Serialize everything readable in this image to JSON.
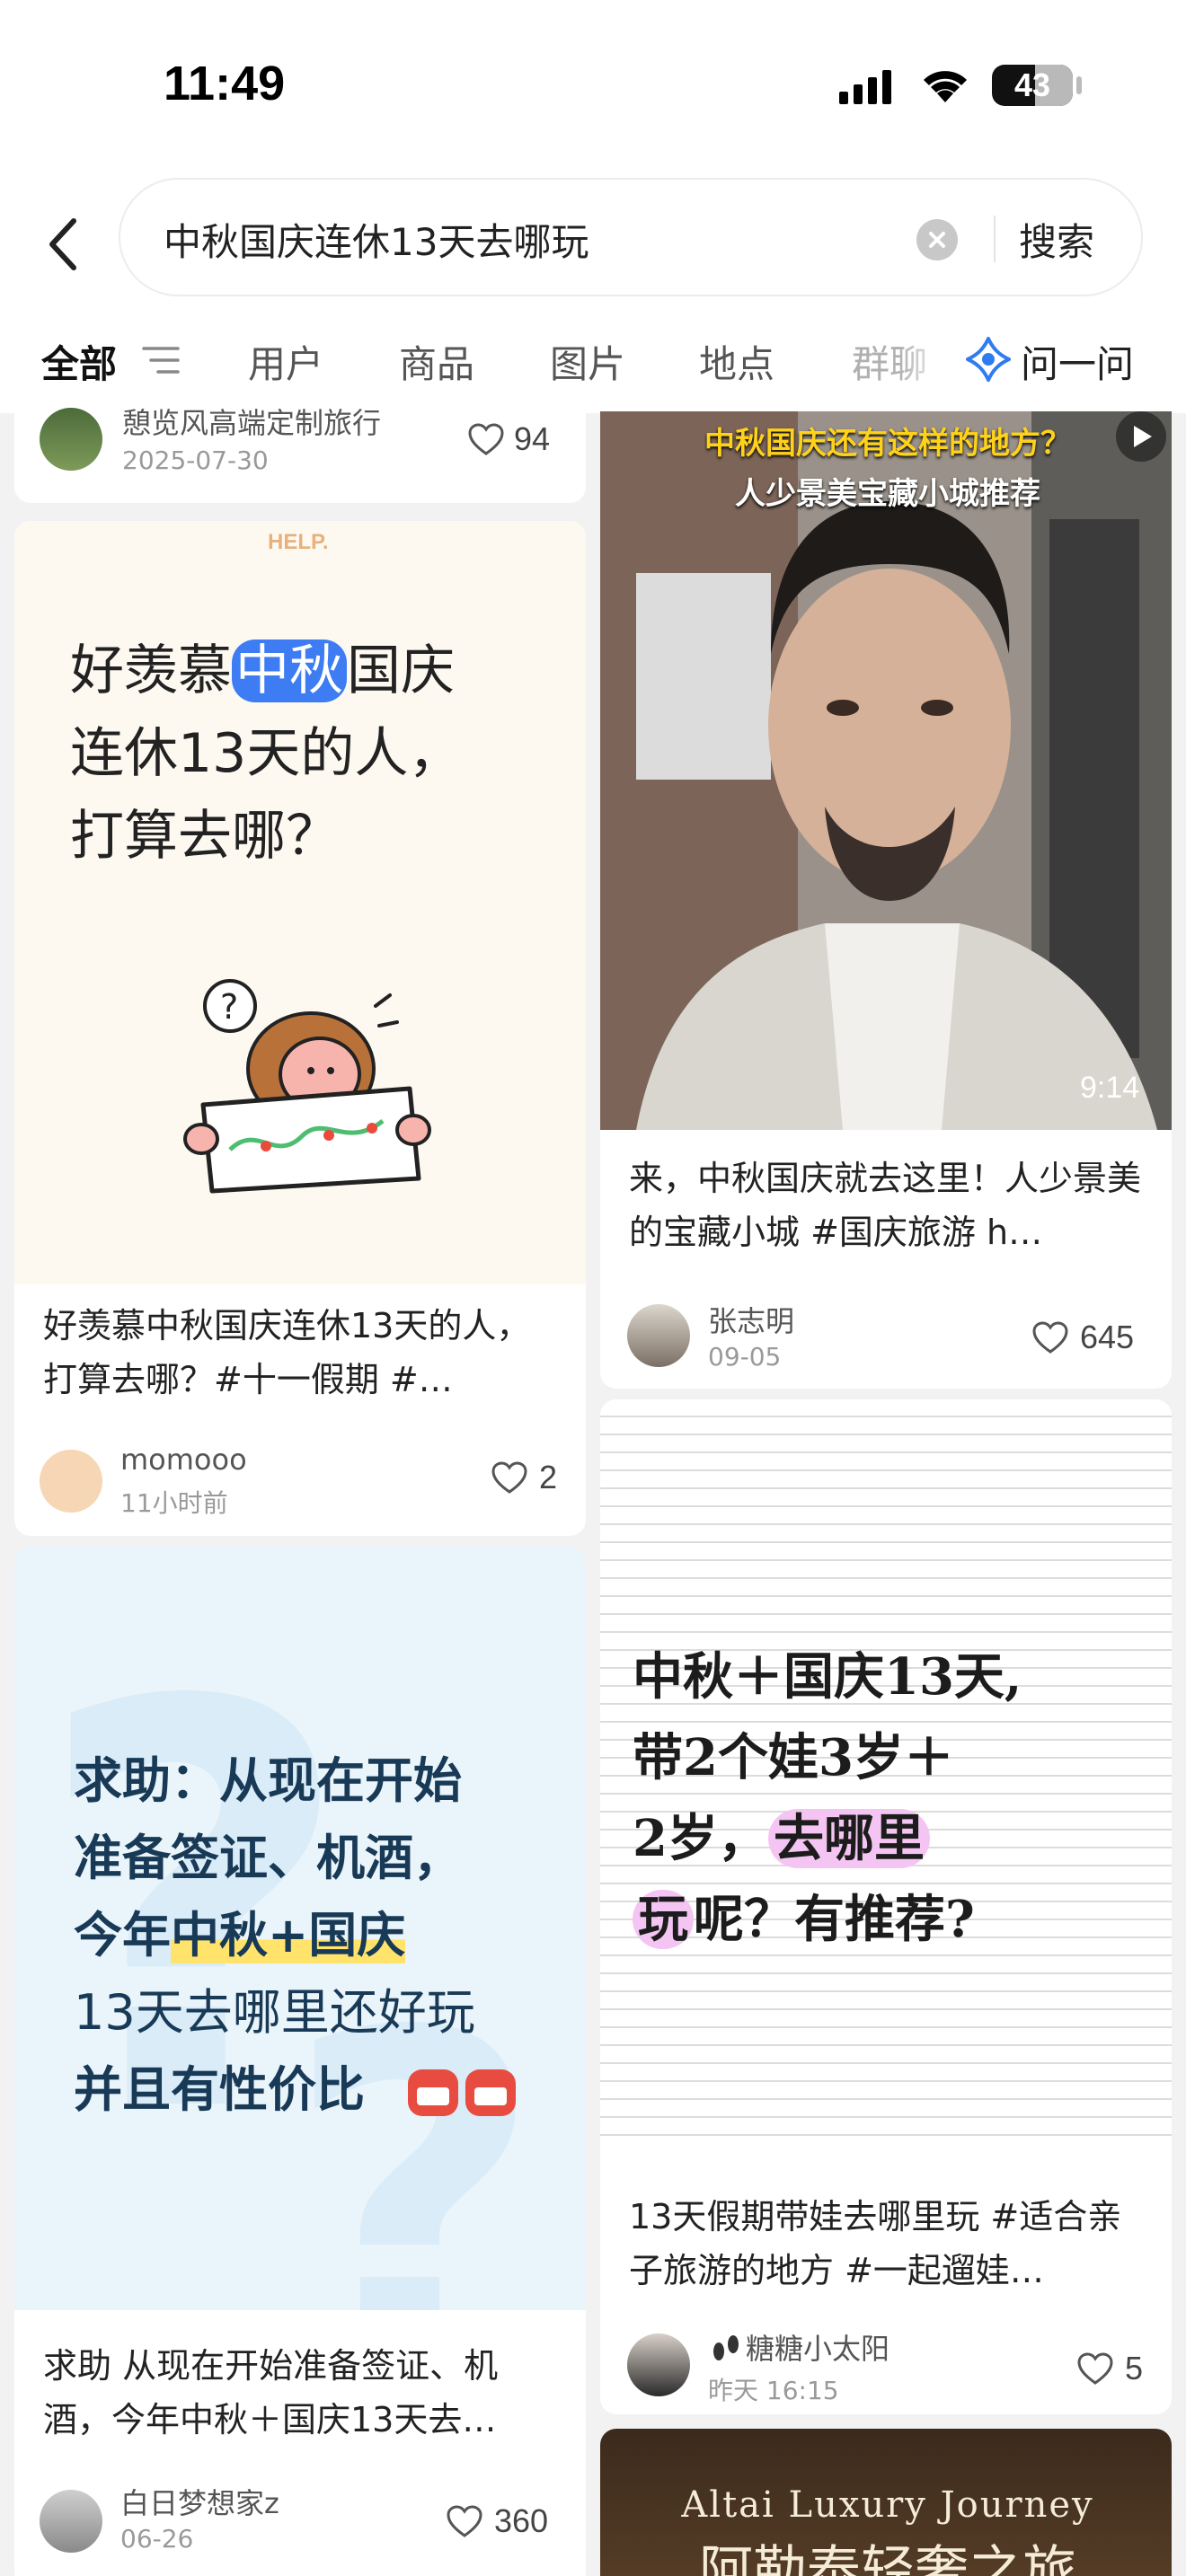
{
  "status": {
    "time": "11:49",
    "battery": "43"
  },
  "search": {
    "query": "中秋国庆连休13天去哪玩",
    "button": "搜索"
  },
  "tabs": [
    "全部",
    "用户",
    "商品",
    "图片",
    "地点",
    "群聊"
  ],
  "ask": "问一问",
  "feed": {
    "left": [
      {
        "author": "憩览风高端定制旅行",
        "date": "2025-07-30",
        "likes": "94"
      },
      {
        "cover_tag": "HELP.",
        "cover_lines": [
          "好羡慕",
          "中秋",
          "国庆",
          "连休13天的人，",
          "打算去哪？"
        ],
        "title": "好羡慕中秋国庆连休13天的人，打算去哪？#十一假期 #…",
        "author": "momooo",
        "date": "11小时前",
        "likes": "2"
      },
      {
        "cover_lines": [
          "求助：从现在开始",
          "准备签证、机酒，",
          "今年",
          "中秋+国庆",
          "13天去哪里还好玩",
          "并且有性价比"
        ],
        "title": "求助 从现在开始准备签证、机酒，今年中秋＋国庆13天去…",
        "author": "白日梦想家z",
        "date": "06-26",
        "likes": "360"
      }
    ],
    "right": [
      {
        "caption_top": "中秋国庆还有这样的地方？",
        "caption_sub": "人少景美宝藏小城推荐",
        "duration": "9:14",
        "title": "来，中秋国庆就去这里！人少景美的宝藏小城 #国庆旅游 h…",
        "author": "张志明",
        "date": "09-05",
        "likes": "645"
      },
      {
        "cover_lines": [
          "中秋＋国庆13天,",
          "带2个娃3岁＋",
          "2岁，",
          "去哪里",
          "玩",
          "呢？有推荐?"
        ],
        "title": "13天假期带娃去哪里玩 #适合亲子旅游的地方 #一起遛娃…",
        "author": "糖糖小太阳",
        "date": "昨天 16:15",
        "likes": "5"
      },
      {
        "cover_en": "Altai  Luxury Journey",
        "cover_cn": "阿勒泰轻奢之旅"
      }
    ]
  },
  "colors": {
    "accent": "#ff2442",
    "highlight_blue": "#3d7cf2",
    "highlight_pink": "#f4c5f2"
  }
}
